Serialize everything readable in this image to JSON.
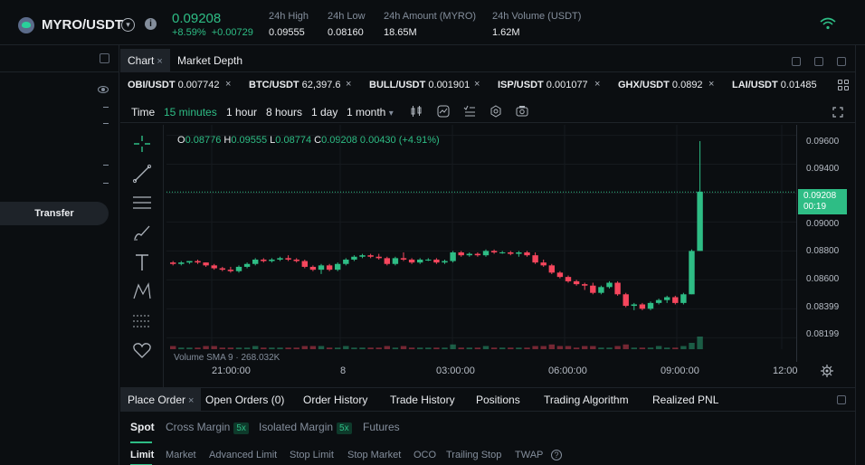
{
  "ticker": {
    "pair": "MYRO/USDT",
    "price": "0.09208",
    "change_pct": "+8.59%",
    "change_abs": "+0.00729",
    "stats": [
      {
        "label": "24h High",
        "value": "0.09555"
      },
      {
        "label": "24h Low",
        "value": "0.08160"
      },
      {
        "label": "24h Amount (MYRO)",
        "value": "18.65M"
      },
      {
        "label": "24h Volume (USDT)",
        "value": "1.62M"
      }
    ]
  },
  "left_panel": {
    "transfer_label": "Transfer"
  },
  "chart_tabs": [
    {
      "label": "Chart",
      "close": "×"
    },
    {
      "label": "Market Depth"
    }
  ],
  "watchlist": [
    {
      "pair": "OBI/USDT",
      "price": "0.007742"
    },
    {
      "pair": "BTC/USDT",
      "price": "62,397.6"
    },
    {
      "pair": "BULL/USDT",
      "price": "0.001901"
    },
    {
      "pair": "ISP/USDT",
      "price": "0.001077"
    },
    {
      "pair": "GHX/USDT",
      "price": "0.0892"
    },
    {
      "pair": "LAI/USDT",
      "price": "0.01485"
    }
  ],
  "toolbar": {
    "time_label": "Time",
    "intervals": [
      "15 minutes",
      "1 hour",
      "8 hours",
      "1 day",
      "1 month"
    ],
    "active_interval": "15 minutes",
    "dropdown_caret": "▾"
  },
  "ohlc": {
    "o_key": "O",
    "o": "0.08776",
    "h_key": "H",
    "h": "0.09555",
    "l_key": "L",
    "l": "0.08774",
    "c_key": "C",
    "c": "0.09208",
    "chg": "0.00430",
    "chg_pct": "(+4.91%)"
  },
  "price_axis": {
    "ticks": [
      "0.09600",
      "0.09400",
      "0.09200",
      "0.09000",
      "0.08800",
      "0.08600",
      "0.08399",
      "0.08199"
    ],
    "current_price": "0.09208",
    "countdown": "00:19"
  },
  "volume_label": "Volume SMA 9 · 268.032K",
  "time_axis": [
    "21:00:00",
    "8",
    "03:00:00",
    "06:00:00",
    "09:00:00",
    "12:00"
  ],
  "colors": {
    "up": "#2ebd85",
    "down": "#f6465d",
    "background": "#0b0e11"
  },
  "chart_data": {
    "type": "candlestick",
    "interval": "15 minutes",
    "yrange": [
      0.0812,
      0.0966
    ],
    "x_ticks": [
      "21:00:00",
      "8",
      "03:00:00",
      "06:00:00",
      "09:00:00",
      "12:00"
    ],
    "candles": [
      [
        0.0872,
        0.0873,
        0.087,
        0.0871
      ],
      [
        0.0871,
        0.0873,
        0.087,
        0.0872
      ],
      [
        0.0872,
        0.0873,
        0.0871,
        0.0873
      ],
      [
        0.0873,
        0.0874,
        0.0871,
        0.0872
      ],
      [
        0.0872,
        0.0872,
        0.0869,
        0.087
      ],
      [
        0.087,
        0.0871,
        0.0867,
        0.0868
      ],
      [
        0.0868,
        0.0869,
        0.0866,
        0.0867
      ],
      [
        0.0867,
        0.0869,
        0.0865,
        0.0866
      ],
      [
        0.0866,
        0.087,
        0.0865,
        0.0869
      ],
      [
        0.0869,
        0.0872,
        0.0868,
        0.0871
      ],
      [
        0.0871,
        0.0875,
        0.087,
        0.0874
      ],
      [
        0.0874,
        0.0875,
        0.0872,
        0.0873
      ],
      [
        0.0873,
        0.0875,
        0.0872,
        0.0874
      ],
      [
        0.0874,
        0.0876,
        0.0873,
        0.0875
      ],
      [
        0.0875,
        0.0877,
        0.0873,
        0.0874
      ],
      [
        0.0874,
        0.0875,
        0.0872,
        0.0873
      ],
      [
        0.0873,
        0.0874,
        0.0868,
        0.0869
      ],
      [
        0.0869,
        0.087,
        0.0866,
        0.0867
      ],
      [
        0.0867,
        0.0871,
        0.0864,
        0.087
      ],
      [
        0.087,
        0.0871,
        0.0866,
        0.0867
      ],
      [
        0.0867,
        0.0872,
        0.0866,
        0.0871
      ],
      [
        0.0871,
        0.0875,
        0.087,
        0.0874
      ],
      [
        0.0874,
        0.0877,
        0.0873,
        0.0876
      ],
      [
        0.0876,
        0.0878,
        0.0875,
        0.0877
      ],
      [
        0.0877,
        0.0878,
        0.0875,
        0.0876
      ],
      [
        0.0876,
        0.0878,
        0.0874,
        0.0875
      ],
      [
        0.0875,
        0.0876,
        0.087,
        0.0871
      ],
      [
        0.0871,
        0.0876,
        0.087,
        0.0875
      ],
      [
        0.0875,
        0.0879,
        0.0873,
        0.0874
      ],
      [
        0.0874,
        0.0875,
        0.0871,
        0.0872
      ],
      [
        0.0872,
        0.0875,
        0.0871,
        0.0874
      ],
      [
        0.0874,
        0.0875,
        0.0873,
        0.0874
      ],
      [
        0.0874,
        0.0875,
        0.0871,
        0.0872
      ],
      [
        0.0872,
        0.0874,
        0.0871,
        0.0873
      ],
      [
        0.0873,
        0.088,
        0.0872,
        0.0879
      ],
      [
        0.0879,
        0.088,
        0.0876,
        0.0877
      ],
      [
        0.0877,
        0.0879,
        0.0876,
        0.0878
      ],
      [
        0.0878,
        0.0879,
        0.0876,
        0.0877
      ],
      [
        0.0877,
        0.0881,
        0.0876,
        0.088
      ],
      [
        0.088,
        0.0881,
        0.0878,
        0.0879
      ],
      [
        0.0879,
        0.088,
        0.0878,
        0.0879
      ],
      [
        0.0879,
        0.088,
        0.0877,
        0.0878
      ],
      [
        0.0878,
        0.088,
        0.0876,
        0.0879
      ],
      [
        0.0879,
        0.088,
        0.0876,
        0.0877
      ],
      [
        0.0877,
        0.0879,
        0.0871,
        0.0872
      ],
      [
        0.0872,
        0.0874,
        0.0869,
        0.087
      ],
      [
        0.087,
        0.0871,
        0.0864,
        0.0865
      ],
      [
        0.0865,
        0.0866,
        0.0861,
        0.0862
      ],
      [
        0.0862,
        0.0863,
        0.0858,
        0.0859
      ],
      [
        0.0859,
        0.086,
        0.0856,
        0.0857
      ],
      [
        0.0857,
        0.0858,
        0.0853,
        0.0856
      ],
      [
        0.0856,
        0.0858,
        0.085,
        0.0851
      ],
      [
        0.0851,
        0.0856,
        0.085,
        0.0855
      ],
      [
        0.0855,
        0.0859,
        0.0854,
        0.0858
      ],
      [
        0.0858,
        0.0859,
        0.0849,
        0.085
      ],
      [
        0.085,
        0.0851,
        0.0841,
        0.0842
      ],
      [
        0.0842,
        0.0844,
        0.0839,
        0.0843
      ],
      [
        0.0843,
        0.0844,
        0.0839,
        0.084
      ],
      [
        0.084,
        0.0845,
        0.0839,
        0.0844
      ],
      [
        0.0844,
        0.0847,
        0.0843,
        0.0846
      ],
      [
        0.0846,
        0.0849,
        0.0844,
        0.0848
      ],
      [
        0.0848,
        0.0849,
        0.0843,
        0.0844
      ],
      [
        0.0844,
        0.0851,
        0.0843,
        0.085
      ],
      [
        0.085,
        0.0881,
        0.085,
        0.088
      ],
      [
        0.088,
        0.0956,
        0.088,
        0.0921
      ]
    ],
    "volume": [
      2,
      1,
      1,
      1,
      2,
      2,
      1,
      1,
      1,
      1,
      2,
      1,
      1,
      1,
      1,
      1,
      2,
      2,
      2,
      1,
      1,
      2,
      1,
      1,
      1,
      1,
      2,
      1,
      2,
      1,
      1,
      1,
      1,
      1,
      3,
      1,
      1,
      1,
      2,
      1,
      1,
      1,
      1,
      1,
      2,
      2,
      3,
      2,
      2,
      1,
      2,
      2,
      1,
      1,
      2,
      3,
      1,
      1,
      1,
      2,
      1,
      1,
      2,
      4,
      8
    ]
  },
  "order_panel": {
    "tabs": [
      "Place Order",
      "Open Orders (0)",
      "Order History",
      "Trade History",
      "Positions",
      "Trading Algorithm",
      "Realized PNL"
    ],
    "close": "×",
    "modes": [
      {
        "label": "Spot"
      },
      {
        "label": "Cross Margin",
        "badge": "5x"
      },
      {
        "label": "Isolated Margin",
        "badge": "5x"
      },
      {
        "label": "Futures"
      }
    ],
    "order_types": [
      "Limit",
      "Market",
      "Advanced Limit",
      "Stop Limit",
      "Stop Market",
      "OCO",
      "Trailing Stop",
      "TWAP"
    ],
    "help": "?"
  }
}
